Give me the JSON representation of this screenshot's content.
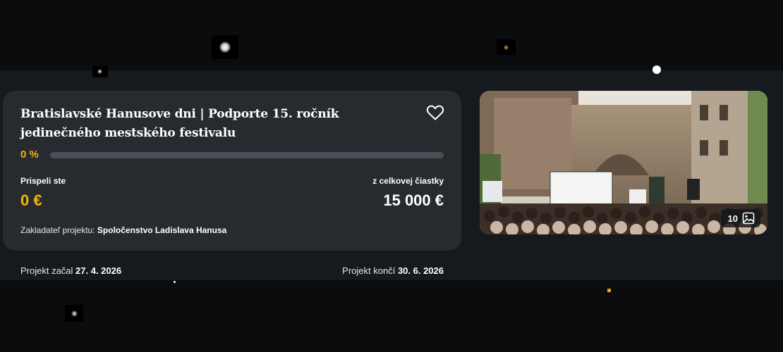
{
  "project": {
    "title": "Bratislavské Hanusove dni | Podporte 15. ročník jedinečného mestského festivalu",
    "progress_label": "0 %",
    "progress_fraction": 0,
    "contributed_label": "Prispeli ste",
    "contributed_amount": "0 €",
    "target_label": "z celkovej čiastky",
    "target_amount": "15 000 €",
    "founder_label": "Zakladateľ projektu:",
    "founder_name": "Spoločenstvo Ladislava Hanusa"
  },
  "gallery": {
    "count": "10"
  },
  "dates": {
    "start_label": "Projekt začal",
    "start_date": "27. 4. 2026",
    "end_label": "Projekt končí",
    "end_date": "30. 6. 2026"
  },
  "colors": {
    "accent": "#f2b705",
    "card": "#272b30",
    "band": "#16191d",
    "track": "#4a4f56"
  },
  "icons": {
    "favorite": "heart-outline-icon",
    "gallery": "image-icon"
  }
}
